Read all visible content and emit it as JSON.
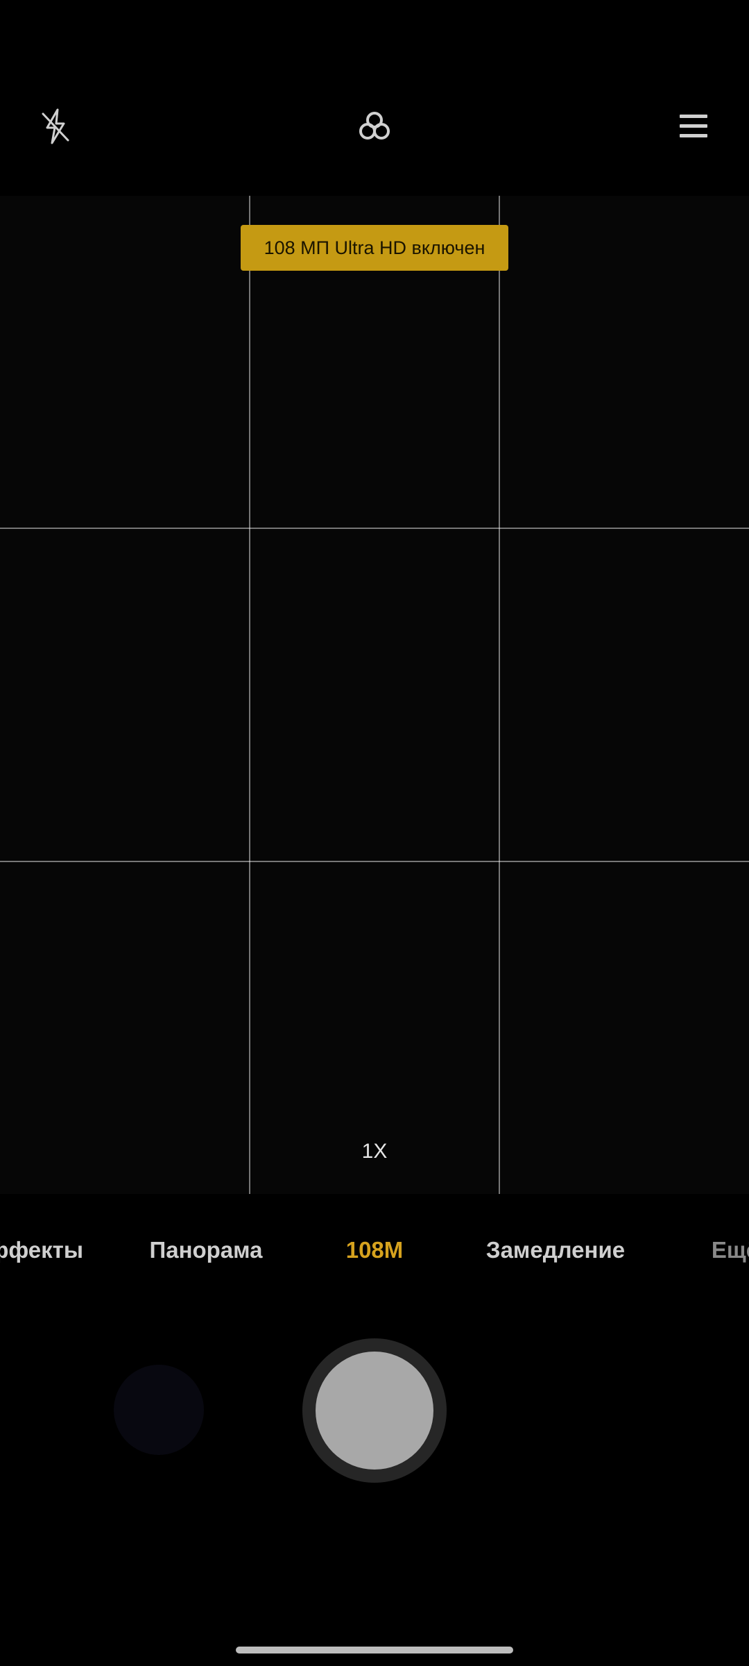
{
  "top_bar": {
    "flash_icon": "flash-off-icon",
    "filter_icon": "filters-icon",
    "menu_icon": "menu-icon"
  },
  "viewfinder": {
    "toast_text": "108 МП Ultra HD включен",
    "zoom_label": "1X"
  },
  "modes": [
    {
      "label": "Эффекты"
    },
    {
      "label": "Панорама"
    },
    {
      "label": "108M"
    },
    {
      "label": "Замедление"
    },
    {
      "label": "Ещё"
    }
  ],
  "active_mode": "108M",
  "colors": {
    "accent": "#d6a21e",
    "toast_background": "#c59a13"
  }
}
